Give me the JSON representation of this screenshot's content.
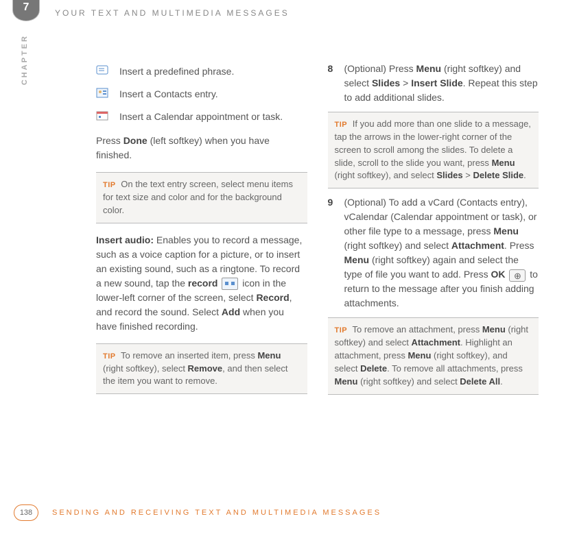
{
  "chapter_num": "7",
  "chapter_label": "CHAPTER",
  "header_title": "YOUR TEXT AND MULTIMEDIA MESSAGES",
  "left": {
    "insert_phrase": "Insert a predefined phrase.",
    "insert_contacts": "Insert a Contacts entry.",
    "insert_calendar": "Insert a Calendar appointment or task.",
    "press_done_pre": "Press ",
    "press_done_bold": "Done",
    "press_done_post": " (left softkey) when you have finished.",
    "tip1": "On the text entry screen, select menu items for text size and color and for the background color.",
    "audio_label": "Insert audio:",
    "audio_1": " Enables you to record a message, such as a voice caption for a picture, or to insert an existing sound, such as a ringtone. To record a new sound, tap the ",
    "audio_record": "record",
    "audio_2": " icon in the lower-left corner of the screen, select ",
    "audio_record2": "Record",
    "audio_3": ", and record the sound. Select ",
    "audio_add": "Add",
    "audio_4": " when you have finished recording.",
    "tip2_a": "To remove an inserted item, press ",
    "tip2_menu": "Menu",
    "tip2_b": " (right softkey), select ",
    "tip2_remove": "Remove",
    "tip2_c": ", and then select the item you want to remove."
  },
  "right": {
    "step8_num": "8",
    "step8_a": "(Optional) Press ",
    "step8_menu": "Menu",
    "step8_b": " (right softkey) and select ",
    "step8_slides": "Slides",
    "step8_gt": " > ",
    "step8_insert": "Insert Slide",
    "step8_c": ". Repeat this step to add additional slides.",
    "tip3_a": "If you add more than one slide to a message, tap the arrows in the lower-right corner of the screen to scroll among the slides. To delete a slide, scroll to the slide you want, press ",
    "tip3_menu": "Menu",
    "tip3_b": " (right softkey), and select ",
    "tip3_slides": "Slides",
    "tip3_gt": " > ",
    "tip3_delete": "Delete Slide",
    "tip3_c": ".",
    "step9_num": "9",
    "step9_a": "(Optional) To add a vCard (Contacts entry), vCalendar (Calendar appointment or task), or other file type to a message, press ",
    "step9_menu1": "Menu",
    "step9_b": " (right softkey) and select ",
    "step9_attach": "Attachment",
    "step9_c": ". Press ",
    "step9_menu2": "Menu",
    "step9_d": " (right softkey) again and select the type of file you want to add. Press ",
    "step9_ok": "OK",
    "step9_e": " to return to the message after you finish adding attachments.",
    "tip4_a": "To remove an attachment, press ",
    "tip4_menu1": "Menu",
    "tip4_b": " (right softkey) and select ",
    "tip4_attach": "Attachment",
    "tip4_c": ". Highlight an attachment, press ",
    "tip4_menu2": "Menu",
    "tip4_d": " (right softkey), and select ",
    "tip4_delete": "Delete",
    "tip4_e": ". To remove all attachments, press ",
    "tip4_menu3": "Menu",
    "tip4_f": " (right softkey) and select ",
    "tip4_deleteall": "Delete All",
    "tip4_g": "."
  },
  "tip_label": "TIP",
  "page_num": "138",
  "footer_title": "SENDING AND RECEIVING TEXT AND MULTIMEDIA MESSAGES"
}
